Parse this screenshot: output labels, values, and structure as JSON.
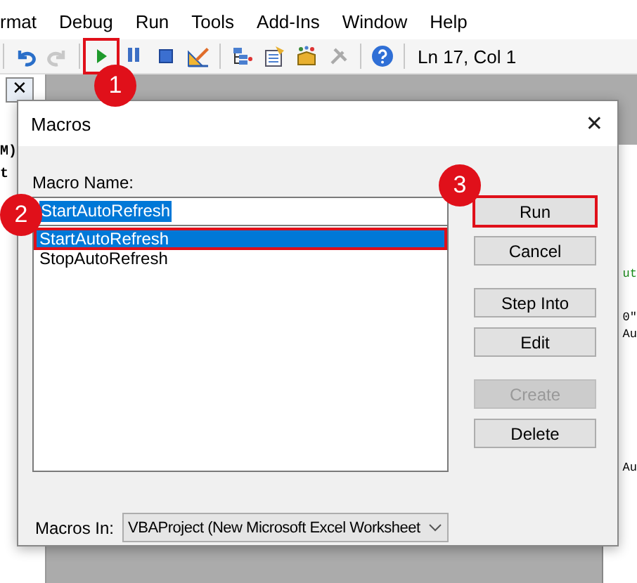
{
  "menu": [
    "rmat",
    "Debug",
    "Run",
    "Tools",
    "Add-Ins",
    "Window",
    "Help"
  ],
  "toolbar": {
    "position": "Ln 17, Col 1"
  },
  "left_pane": {
    "close": "✕",
    "code_fragments": [
      "M)",
      "t"
    ]
  },
  "code_fragments": [
    {
      "text": "ut",
      "kind": "comment"
    },
    {
      "text": "0\"",
      "kind": "code"
    },
    {
      "text": "Au",
      "kind": "code"
    },
    {
      "text": "Au",
      "kind": "code"
    }
  ],
  "dialog": {
    "title": "Macros",
    "close": "✕",
    "name_label": "Macro Name:",
    "name_value": "StartAutoRefresh",
    "macros": [
      {
        "name": "StartAutoRefresh",
        "selected": true
      },
      {
        "name": "StopAutoRefresh",
        "selected": false
      }
    ],
    "buttons": [
      {
        "label": "Run",
        "disabled": false
      },
      {
        "label": "Cancel",
        "disabled": false
      },
      {
        "label": "Step Into",
        "disabled": false
      },
      {
        "label": "Edit",
        "disabled": false
      },
      {
        "label": "Create",
        "disabled": true
      },
      {
        "label": "Delete",
        "disabled": false
      }
    ],
    "macros_in_label": "Macros In:",
    "macros_in_value": "VBAProject (New Microsoft Excel Worksheet"
  },
  "annotations": [
    {
      "number": "1"
    },
    {
      "number": "2"
    },
    {
      "number": "3"
    }
  ]
}
